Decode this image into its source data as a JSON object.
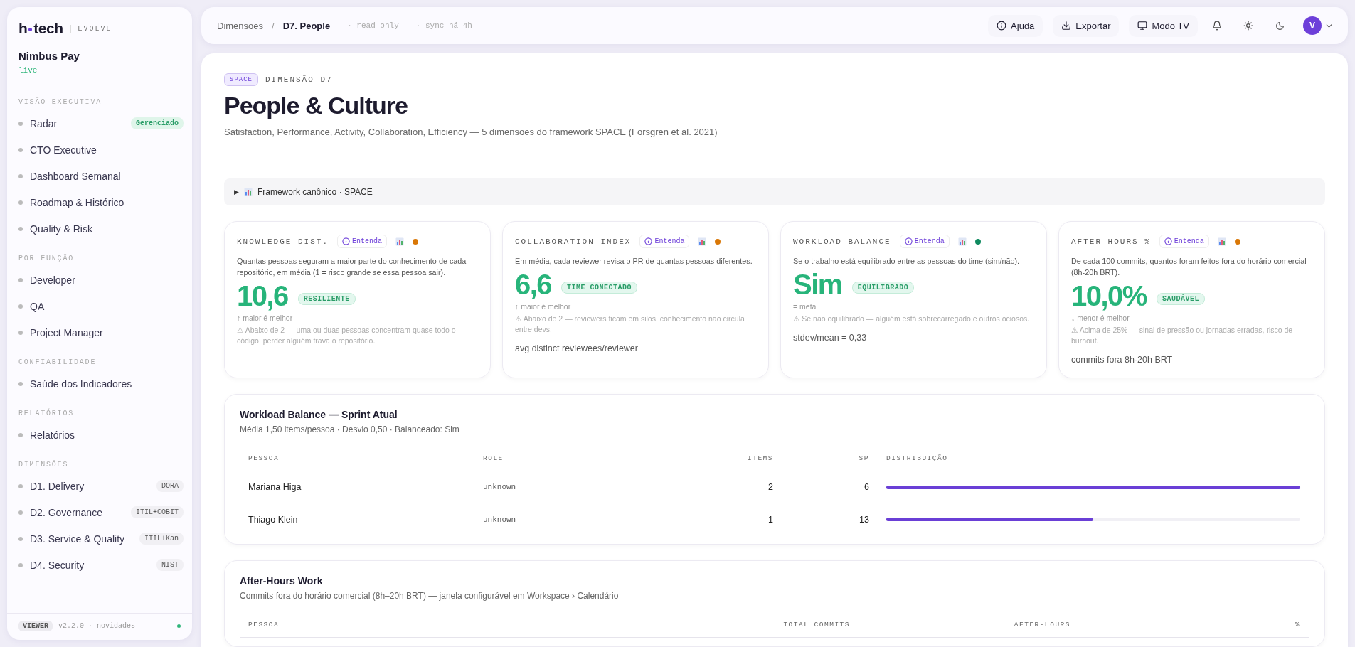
{
  "sidebar": {
    "logo": [
      "h",
      "tech"
    ],
    "product": "EVOLVE",
    "workspace": "Nimbus Pay",
    "env": "live",
    "sections": [
      {
        "title": "VISÃO EXECUTIVA",
        "items": [
          {
            "label": "Radar",
            "badge": {
              "text": "Gerenciado",
              "kind": "status"
            }
          },
          {
            "label": "CTO Executive"
          },
          {
            "label": "Dashboard Semanal"
          },
          {
            "label": "Roadmap & Histórico"
          },
          {
            "label": "Quality & Risk"
          }
        ]
      },
      {
        "title": "POR FUNÇÃO",
        "items": [
          {
            "label": "Developer"
          },
          {
            "label": "QA"
          },
          {
            "label": "Project Manager"
          }
        ]
      },
      {
        "title": "CONFIABILIDADE",
        "items": [
          {
            "label": "Saúde dos Indicadores"
          }
        ]
      },
      {
        "title": "RELATÓRIOS",
        "items": [
          {
            "label": "Relatórios"
          }
        ]
      },
      {
        "title": "DIMENSÕES",
        "items": [
          {
            "label": "D1. Delivery",
            "badge": {
              "text": "DORA",
              "kind": "tag"
            }
          },
          {
            "label": "D2. Governance",
            "badge": {
              "text": "ITIL+COBIT",
              "kind": "tag"
            }
          },
          {
            "label": "D3. Service & Quality",
            "badge": {
              "text": "ITIL+Kan",
              "kind": "tag"
            }
          },
          {
            "label": "D4. Security",
            "badge": {
              "text": "NIST",
              "kind": "tag"
            }
          }
        ]
      }
    ],
    "footer": {
      "role": "VIEWER",
      "version": "v2.2.0 · novidades"
    }
  },
  "topbar": {
    "breadcrumbs": [
      {
        "label": "Dimensões",
        "current": false
      },
      {
        "label": "D7. People",
        "current": true
      }
    ],
    "separator": "/",
    "meta": [
      "· read-only",
      "· sync há 4h"
    ],
    "actions": [
      {
        "label": "Ajuda",
        "kind": "help"
      },
      {
        "label": "Exportar",
        "kind": "export"
      },
      {
        "label": "Modo TV",
        "kind": "tv"
      }
    ],
    "avatar": "V"
  },
  "header": {
    "tag": "SPACE",
    "eyebrow": "DIMENSÃO D7",
    "title": "People & Culture",
    "subtitle": "Satisfaction, Performance, Activity, Collaboration, Efficiency — 5 dimensões do framework SPACE (Forsgren et al. 2021)"
  },
  "disclosure": {
    "marker": "▶",
    "label": "Framework canônico · SPACE",
    "expanded": false
  },
  "metrics": [
    {
      "label": "KNOWLEDGE DIST.",
      "help": "Entenda",
      "color": "#d97706",
      "description": "Quantas pessoas seguram a maior parte do conhecimento de cada repositório, em média (1 = risco grande se essa pessoa sair).",
      "value": "10,6",
      "status": "RESILIENTE",
      "direction": "↑ maior é melhor",
      "warning": "⚠ Abaixo de 2 — uma ou duas pessoas concentram quase todo o código; perder alguém trava o repositório."
    },
    {
      "label": "COLLABORATION INDEX",
      "help": "Entenda",
      "color": "#d97706",
      "description": "Em média, cada reviewer revisa o PR de quantas pessoas diferentes.",
      "value": "6,6",
      "status": "TIME CONECTADO",
      "direction": "↑ maior é melhor",
      "warning": "⚠ Abaixo de 2 — reviewers ficam em silos, conhecimento não circula entre devs.",
      "footnote": "avg distinct reviewees/reviewer"
    },
    {
      "label": "WORKLOAD BALANCE",
      "help": "Entenda",
      "color": "#0f8a5f",
      "description": "Se o trabalho está equilibrado entre as pessoas do time (sim/não).",
      "value": "Sim",
      "status": "EQUILIBRADO",
      "direction": "= meta",
      "warning": "⚠ Se não equilibrado — alguém está sobrecarregado e outros ociosos.",
      "footnote": "stdev/mean = 0,33"
    },
    {
      "label": "AFTER-HOURS %",
      "help": "Entenda",
      "color": "#d97706",
      "description": "De cada 100 commits, quantos foram feitos fora do horário comercial (8h-20h BRT).",
      "value": "10,0%",
      "status": "SAUDÁVEL",
      "direction": "↓ menor é melhor",
      "warning": "⚠ Acima de 25% — sinal de pressão ou jornadas erradas, risco de burnout.",
      "footnote": "commits fora 8h-20h BRT"
    }
  ],
  "workload": {
    "title": "Workload Balance — Sprint Atual",
    "subtitle": "Média 1,50 items/pessoa · Desvio 0,50 · Balanceado: Sim",
    "columns": [
      "PESSOA",
      "ROLE",
      "ITEMS",
      "SP",
      "DISTRIBUIÇÃO"
    ],
    "rows": [
      {
        "name": "Mariana Higa",
        "role": "unknown",
        "items": "2",
        "sp": "6",
        "level": 1
      },
      {
        "name": "Thiago Klein",
        "role": "unknown",
        "items": "1",
        "sp": "13",
        "level": 0.5
      }
    ]
  },
  "after_hours": {
    "title": "After-Hours Work",
    "subtitle": "Commits fora do horário comercial (8h–20h BRT) — janela configurável em Workspace › Calendário",
    "columns": [
      "PESSOA",
      "TOTAL COMMITS",
      "AFTER-HOURS",
      "%"
    ]
  }
}
